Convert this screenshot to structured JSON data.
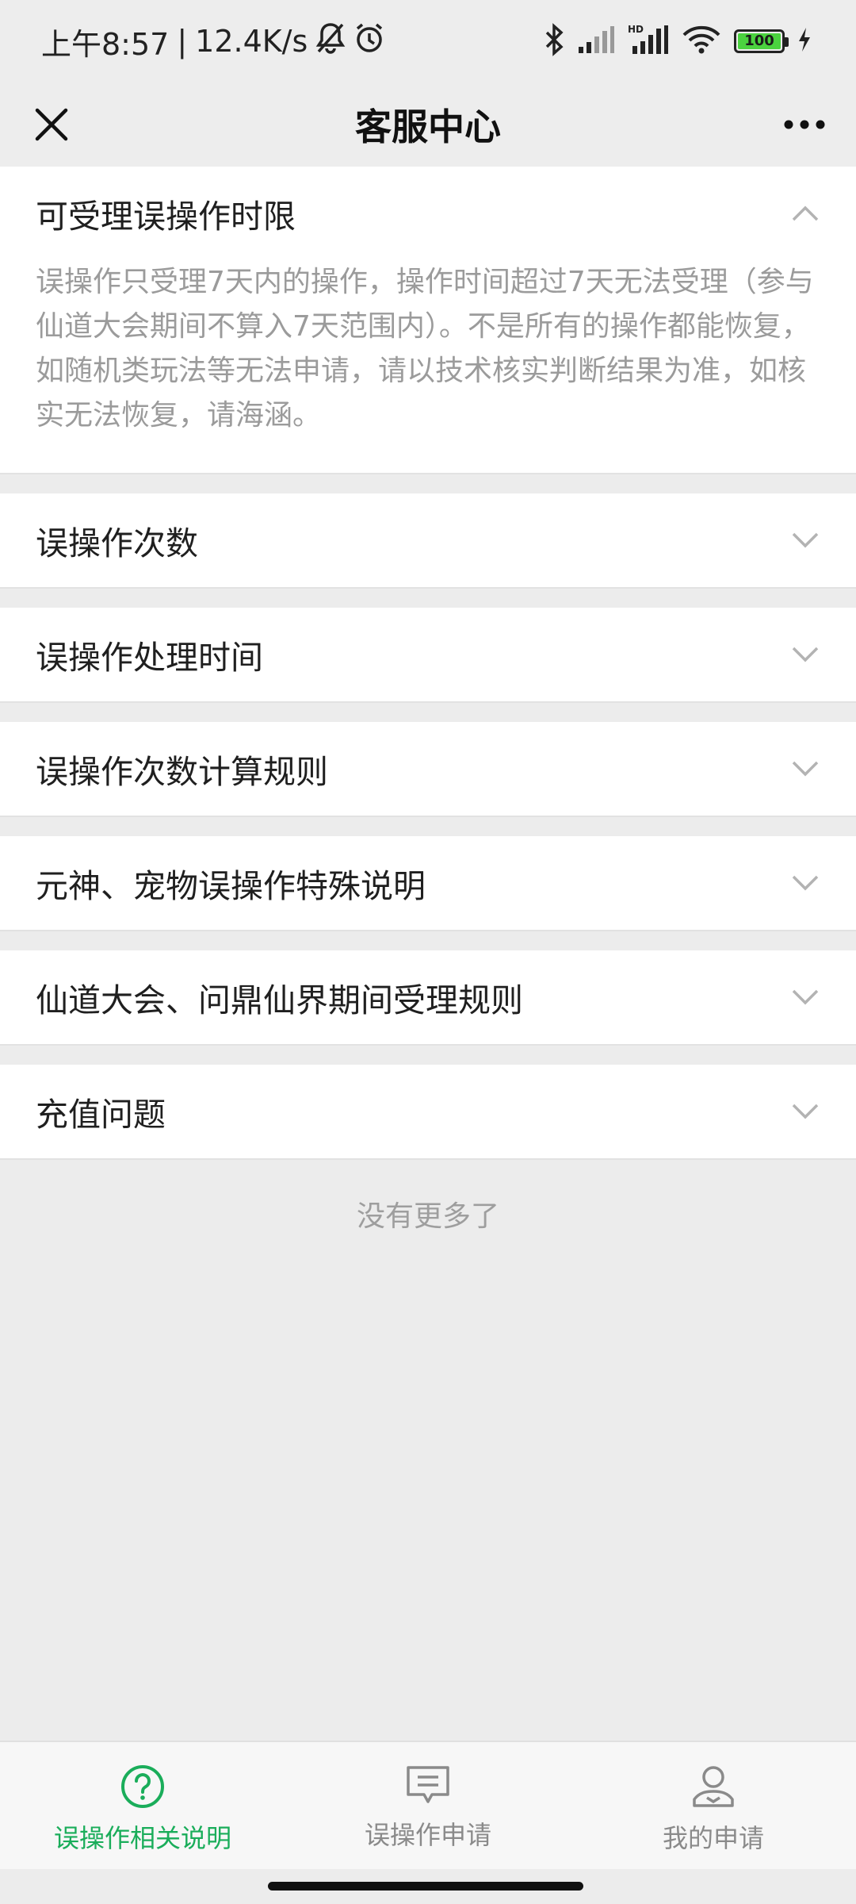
{
  "status_bar": {
    "time": "上午8:57",
    "separator": "|",
    "net_speed": "12.4K/s",
    "battery_level": "100",
    "icons": [
      "mute-bell-icon",
      "alarm-icon",
      "bluetooth-icon",
      "signal-icon",
      "hd-signal-icon",
      "wifi-icon",
      "battery-icon",
      "charging-icon"
    ]
  },
  "nav": {
    "title": "客服中心"
  },
  "sections": [
    {
      "label": "可受理误操作时限",
      "expanded": true,
      "body": "误操作只受理7天内的操作，操作时间超过7天无法受理（参与仙道大会期间不算入7天范围内）。不是所有的操作都能恢复，如随机类玩法等无法申请，请以技术核实判断结果为准，如核实无法恢复，请海涵。"
    },
    {
      "label": "误操作次数",
      "expanded": false
    },
    {
      "label": "误操作处理时间",
      "expanded": false
    },
    {
      "label": "误操作次数计算规则",
      "expanded": false
    },
    {
      "label": "元神、宠物误操作特殊说明",
      "expanded": false
    },
    {
      "label": "仙道大会、问鼎仙界期间受理规则",
      "expanded": false
    },
    {
      "label": "充值问题",
      "expanded": false
    }
  ],
  "end_text": "没有更多了",
  "tabs": [
    {
      "label": "误操作相关说明",
      "icon": "question-circle-icon",
      "active": true
    },
    {
      "label": "误操作申请",
      "icon": "message-icon",
      "active": false
    },
    {
      "label": "我的申请",
      "icon": "user-icon",
      "active": false
    }
  ],
  "colors": {
    "accent": "#1aad5a",
    "background": "#ececec",
    "muted_text": "#9b9b9b"
  }
}
